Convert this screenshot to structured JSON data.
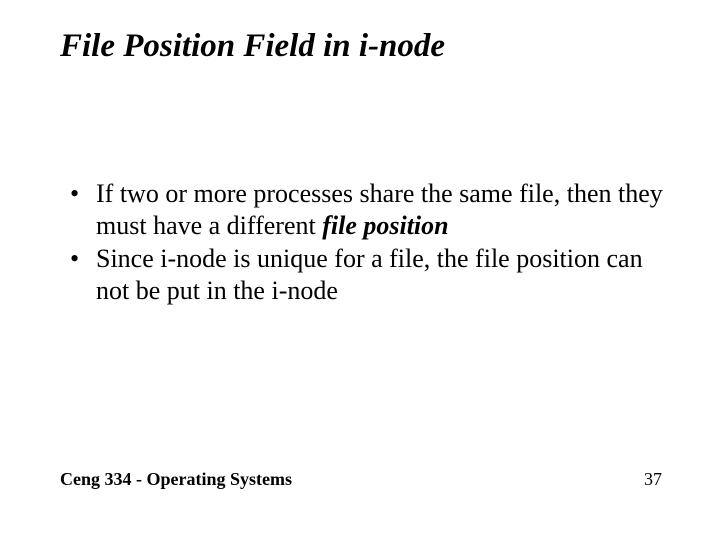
{
  "title": "File Position Field in i-node",
  "bullets": [
    {
      "pre": "If two or more processes share the same file, then they must have a different ",
      "emph": "file position",
      "post": ""
    },
    {
      "pre": "Since i-node is unique for a file, the file position can not be put  in the i-node",
      "emph": "",
      "post": ""
    }
  ],
  "footer": "Ceng 334 - Operating Systems",
  "page_number": "37"
}
